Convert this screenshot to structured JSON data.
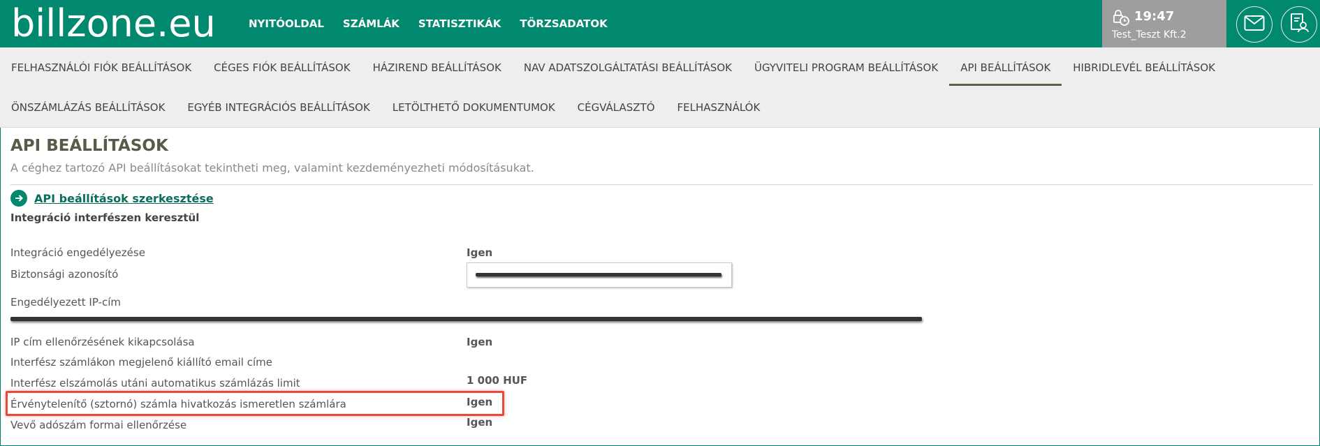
{
  "header": {
    "logo_text": "billzone.eu",
    "nav": [
      "NYITÓOLDAL",
      "SZÁMLÁK",
      "STATISZTIKÁK",
      "TÖRZSADATOK"
    ],
    "time": "19:47",
    "company": "Test_Teszt Kft.2",
    "icons": {
      "clock": "clock-lock-icon",
      "mail": "mail-icon",
      "doc": "document-user-icon"
    },
    "brand_color": "#00896f"
  },
  "subnav": {
    "row1": [
      "FELHASZNÁLÓI FIÓK BEÁLLÍTÁSOK",
      "CÉGES FIÓK BEÁLLÍTÁSOK",
      "HÁZIREND BEÁLLÍTÁSOK",
      "NAV ADATSZOLGÁLTATÁSI BEÁLLÍTÁSOK",
      "ÜGYVITELI PROGRAM BEÁLLÍTÁSOK",
      "API BEÁLLÍTÁSOK",
      "HIBRIDLEVÉL BEÁLLÍTÁSOK"
    ],
    "row2": [
      "ÖNSZÁMLÁZÁS BEÁLLÍTÁSOK",
      "EGYÉB INTEGRÁCIÓS BEÁLLÍTÁSOK",
      "LETÖLTHETŐ DOKUMENTUMOK",
      "CÉGVÁLASZTÓ",
      "FELHASZNÁLÓK"
    ],
    "active": "API BEÁLLÍTÁSOK"
  },
  "page": {
    "title": "API BEÁLLÍTÁSOK",
    "description": "A céghez tartozó API beállításokat tekintheti meg, valamint kezdeményezheti módosításukat.",
    "edit_link": "API beállítások szerkesztése",
    "section_title": "Integráció interfészen keresztül"
  },
  "settings": {
    "integration_enabled": {
      "label": "Integráció engedélyezése",
      "value": "Igen"
    },
    "security_id": {
      "label": "Biztonsági azonosító"
    },
    "allowed_ip": {
      "label": "Engedélyezett IP-cím"
    },
    "ip_check_disable": {
      "label": "IP cím ellenőrzésének kikapcsolása",
      "value": "Igen"
    },
    "issuer_email": {
      "label": "Interfész számlákon megjelenő kiállító email címe"
    },
    "auto_invoice_limit": {
      "label": "Interfész elszámolás utáni automatikus számlázás limit",
      "value": "1 000 HUF"
    },
    "storno_unknown_ref": {
      "label": "Érvénytelenítő (sztornó) számla hivatkozás ismeretlen számlára",
      "value": "Igen"
    },
    "buyer_tax_check": {
      "label": "Vevő adószám formai ellenőrzése",
      "value": "Igen"
    }
  }
}
